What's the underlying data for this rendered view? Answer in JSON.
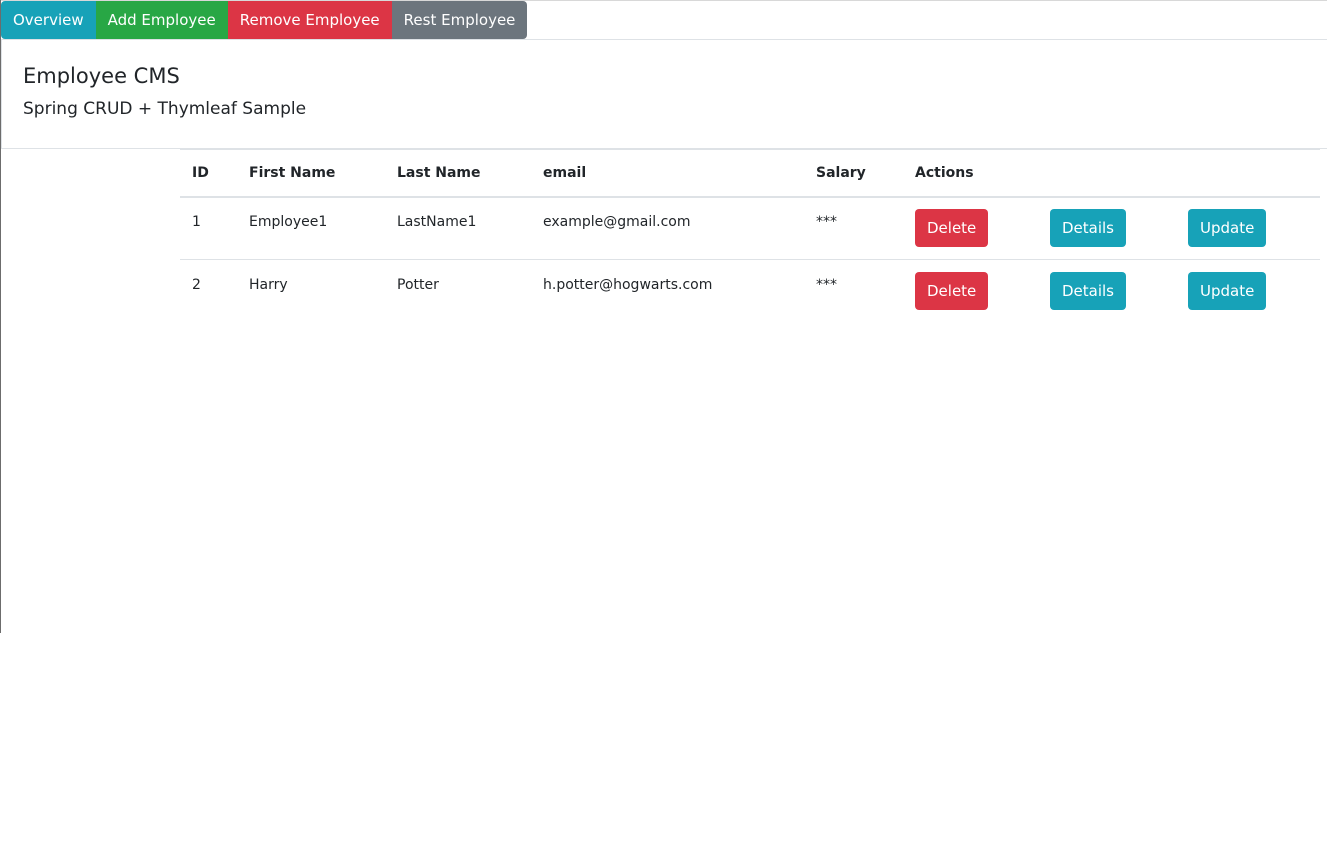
{
  "nav": {
    "items": [
      {
        "label": "Overview",
        "color": "#17a2b8"
      },
      {
        "label": "Add Employee",
        "color": "#28a745"
      },
      {
        "label": "Remove Employee",
        "color": "#dc3545"
      },
      {
        "label": "Rest Employee",
        "color": "#6c757d"
      }
    ]
  },
  "header": {
    "title": "Employee CMS",
    "subtitle": "Spring CRUD + Thymleaf Sample"
  },
  "table": {
    "columns": [
      "ID",
      "First Name",
      "Last Name",
      "email",
      "Salary",
      "Actions"
    ],
    "rows": [
      {
        "id": "1",
        "first_name": "Employee1",
        "last_name": "LastName1",
        "email": "example@gmail.com",
        "salary": "***"
      },
      {
        "id": "2",
        "first_name": "Harry",
        "last_name": "Potter",
        "email": "h.potter@hogwarts.com",
        "salary": "***"
      }
    ],
    "actions": {
      "delete": {
        "label": "Delete",
        "color": "#dc3545"
      },
      "details": {
        "label": "Details",
        "color": "#17a2b8"
      },
      "update": {
        "label": "Update",
        "color": "#17a2b8"
      }
    }
  }
}
